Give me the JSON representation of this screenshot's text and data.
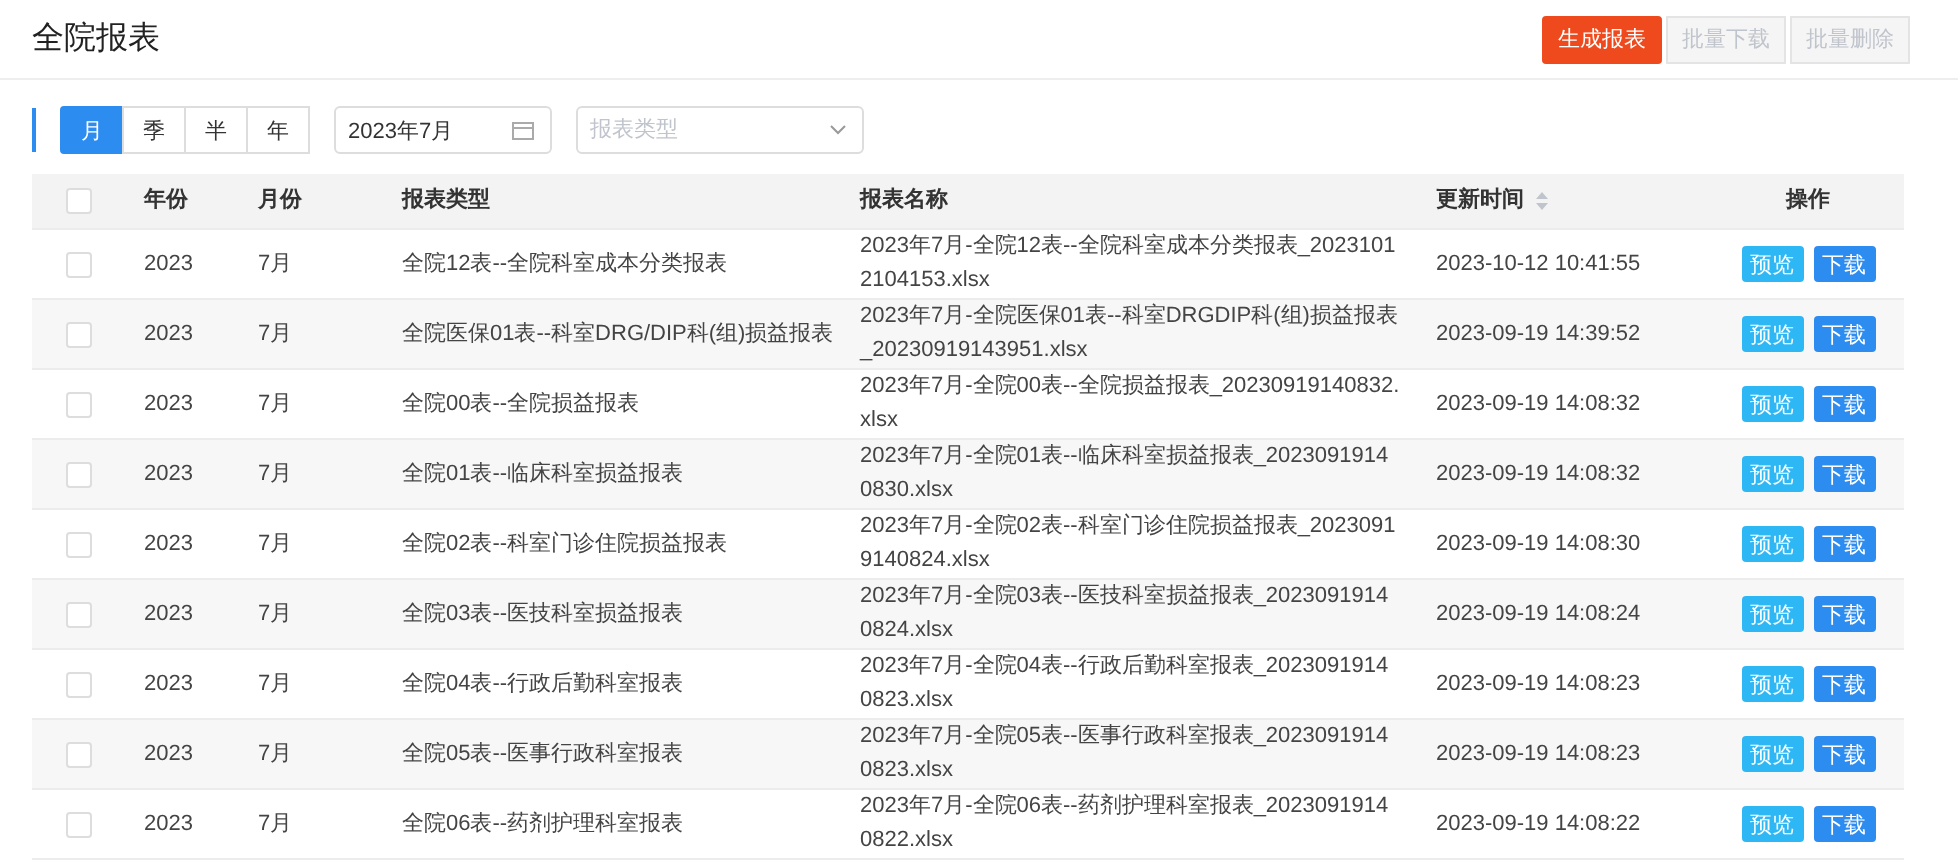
{
  "page_title": "全院报表",
  "actions": [
    {
      "label": "生成报表",
      "disabled": false
    },
    {
      "label": "批量下载",
      "disabled": true
    },
    {
      "label": "批量删除",
      "disabled": true
    }
  ],
  "period_tabs": [
    {
      "label": "月",
      "selected": true
    },
    {
      "label": "季",
      "selected": false
    },
    {
      "label": "半",
      "selected": false
    },
    {
      "label": "年",
      "selected": false
    }
  ],
  "date_field": {
    "value": "2023年7月"
  },
  "type_select": {
    "placeholder": "报表类型"
  },
  "table": {
    "select_all_checked": false,
    "columns": [
      "年份",
      "月份",
      "报表类型",
      "报表名称",
      "更新时间",
      "操作"
    ],
    "rows": [
      {
        "checked": false,
        "year": "2023",
        "month": "7月",
        "type": "全院12表--全院科室成本分类报表",
        "name": "2023年7月-全院12表--全院科室成本分类报表_20231012104153.xlsx",
        "updated": "2023-10-12 10:41:55",
        "actions": [
          "预览",
          "下载"
        ]
      },
      {
        "checked": false,
        "year": "2023",
        "month": "7月",
        "type": "全院医保01表--科室DRG/DIP科(组)损益报表",
        "name": "2023年7月-全院医保01表--科室DRGDIP科(组)损益报表_20230919143951.xlsx",
        "updated": "2023-09-19 14:39:52",
        "actions": [
          "预览",
          "下载"
        ]
      },
      {
        "checked": false,
        "year": "2023",
        "month": "7月",
        "type": "全院00表--全院损益报表",
        "name": "2023年7月-全院00表--全院损益报表_20230919140832.xlsx",
        "updated": "2023-09-19 14:08:32",
        "actions": [
          "预览",
          "下载"
        ]
      },
      {
        "checked": false,
        "year": "2023",
        "month": "7月",
        "type": "全院01表--临床科室损益报表",
        "name": "2023年7月-全院01表--临床科室损益报表_20230919140830.xlsx",
        "updated": "2023-09-19 14:08:32",
        "actions": [
          "预览",
          "下载"
        ]
      },
      {
        "checked": false,
        "year": "2023",
        "month": "7月",
        "type": "全院02表--科室门诊住院损益报表",
        "name": "2023年7月-全院02表--科室门诊住院损益报表_20230919140824.xlsx",
        "updated": "2023-09-19 14:08:30",
        "actions": [
          "预览",
          "下载"
        ]
      },
      {
        "checked": false,
        "year": "2023",
        "month": "7月",
        "type": "全院03表--医技科室损益报表",
        "name": "2023年7月-全院03表--医技科室损益报表_20230919140824.xlsx",
        "updated": "2023-09-19 14:08:24",
        "actions": [
          "预览",
          "下载"
        ]
      },
      {
        "checked": false,
        "year": "2023",
        "month": "7月",
        "type": "全院04表--行政后勤科室报表",
        "name": "2023年7月-全院04表--行政后勤科室报表_20230919140823.xlsx",
        "updated": "2023-09-19 14:08:23",
        "actions": [
          "预览",
          "下载"
        ]
      },
      {
        "checked": false,
        "year": "2023",
        "month": "7月",
        "type": "全院05表--医事行政科室报表",
        "name": "2023年7月-全院05表--医事行政科室报表_20230919140823.xlsx",
        "updated": "2023-09-19 14:08:23",
        "actions": [
          "预览",
          "下载"
        ]
      },
      {
        "checked": false,
        "year": "2023",
        "month": "7月",
        "type": "全院06表--药剂护理科室报表",
        "name": "2023年7月-全院06表--药剂护理科室报表_20230919140822.xlsx",
        "updated": "2023-09-19 14:08:22",
        "actions": [
          "预览",
          "下载"
        ]
      }
    ]
  }
}
